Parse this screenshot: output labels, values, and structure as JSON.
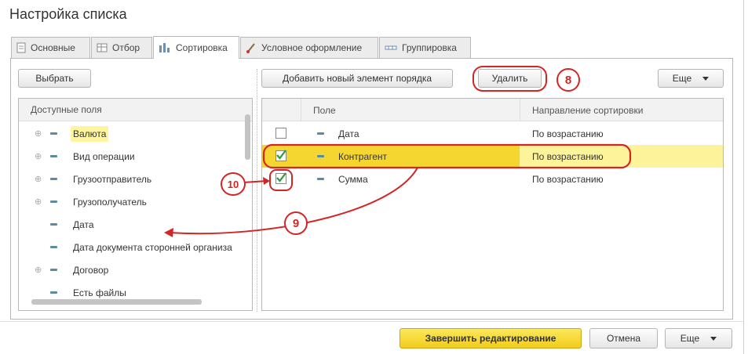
{
  "window": {
    "title": "Настройка списка"
  },
  "tabs": [
    {
      "label": "Основные",
      "icon": "page-icon"
    },
    {
      "label": "Отбор",
      "icon": "filter-icon"
    },
    {
      "label": "Сортировка",
      "icon": "sort-icon"
    },
    {
      "label": "Условное оформление",
      "icon": "brush-icon"
    },
    {
      "label": "Группировка",
      "icon": "group-icon"
    }
  ],
  "left_panel": {
    "select_button": "Выбрать",
    "list_header": "Доступные поля",
    "fields": [
      {
        "label": "Валюта",
        "expandable": true,
        "highlighted": true
      },
      {
        "label": "Вид операции",
        "expandable": true
      },
      {
        "label": "Грузоотправитель",
        "expandable": true
      },
      {
        "label": "Грузополучатель",
        "expandable": true
      },
      {
        "label": "Дата",
        "expandable": false
      },
      {
        "label": "Дата документа сторонней организа",
        "expandable": false
      },
      {
        "label": "Договор",
        "expandable": true
      },
      {
        "label": "Есть файлы",
        "expandable": false
      }
    ]
  },
  "right_panel": {
    "add_button": "Добавить новый элемент порядка",
    "delete_button": "Удалить",
    "more_button": "Еще",
    "columns": {
      "field": "Поле",
      "direction": "Направление сортировки"
    },
    "rows": [
      {
        "field": "Дата",
        "direction": "По возрастанию",
        "checked": false,
        "selected": false
      },
      {
        "field": "Контрагент",
        "direction": "По возрастанию",
        "checked": true,
        "selected": true
      },
      {
        "field": "Сумма",
        "direction": "По возрастанию",
        "checked": true,
        "selected": false
      }
    ]
  },
  "footer": {
    "finish_button": "Завершить редактирование",
    "cancel_button": "Отмена",
    "more_button": "Еще"
  },
  "annotations": {
    "a8": "8",
    "a9": "9",
    "a10": "10"
  },
  "colors": {
    "annotation_red": "#d32525",
    "accent_yellow": "#f5d630",
    "selection_yellow": "#fdf39a",
    "check_green": "#2e9a3a"
  }
}
